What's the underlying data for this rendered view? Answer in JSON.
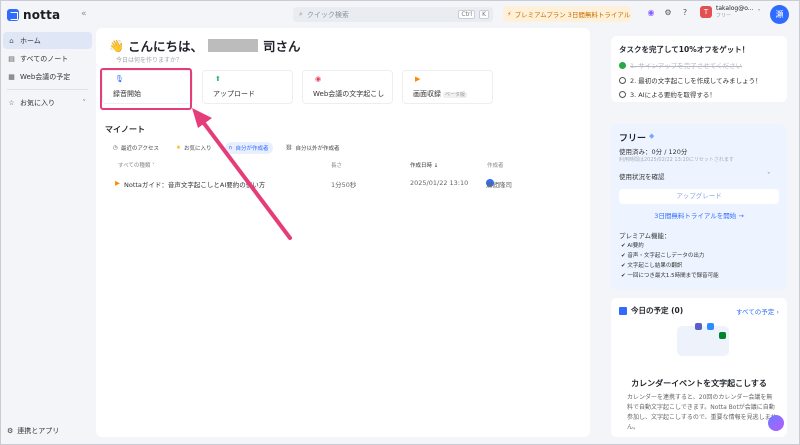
{
  "app": {
    "logo_text": "notta",
    "collapse_icon": "«"
  },
  "sidebar": {
    "items": [
      {
        "label": "ホーム",
        "icon": "home-icon",
        "active": true
      },
      {
        "label": "すべてのノート",
        "icon": "notes-icon"
      },
      {
        "label": "Web会議の予定",
        "icon": "calendar-icon"
      },
      {
        "label": "お気に入り",
        "icon": "star-icon"
      }
    ],
    "bottom_label": "連携とアプリ"
  },
  "topbar": {
    "search_placeholder": "クイック検索",
    "kbd_ctrl": "Ctrl",
    "kbd_k": "K",
    "promo": "プレミアムプラン 3日間無料トライアル",
    "user_name": "takalog@o...",
    "user_plan": "フリー",
    "user_initial": "T",
    "avatar_text": "瀬"
  },
  "home": {
    "greeting_prefix": "こんにちは、",
    "greeting_suffix": "司さん",
    "sub": "今日は何を作りますか？",
    "cards": [
      {
        "label": "録音開始",
        "icon": "mic-icon"
      },
      {
        "label": "アップロード",
        "icon": "upload-icon"
      },
      {
        "label": "Web会議の文字起こし",
        "icon": "meeting-icon"
      },
      {
        "label": "画面収録",
        "icon": "screen-record-icon",
        "badge": "ベータ版"
      }
    ],
    "mynotes_title": "マイノート",
    "filters": [
      "最近のアクセス",
      "お気に入り",
      "自分が作成者",
      "自分以外が作成者"
    ],
    "columns": {
      "type": "すべての種類 ˅",
      "length": "長さ",
      "created": "作成日時 ↓",
      "author": "作成者"
    },
    "rows": [
      {
        "title": "Nottaガイド：音声文字起こしとAI要約の使い方",
        "length": "1分50秒",
        "created": "2025/01/22 13:10",
        "author": "瀬間隆司"
      }
    ]
  },
  "task": {
    "title": "タスクを完了して10%オフをゲット！",
    "items": [
      {
        "label": "1. サインアップを完了させてください",
        "done": true
      },
      {
        "label": "2. 最初の文字起こしを作成してみましょう！",
        "done": false
      },
      {
        "label": "3. AIによる要約を取得する！",
        "done": false
      }
    ]
  },
  "plan": {
    "name": "フリー",
    "usage": "使用済み：0分 / 120分",
    "reset": "利用時間は2025/02/22 13:10にリセットされます",
    "check_usage": "使用状況を確認",
    "upgrade": "アップグレード",
    "trial": "3日間無料トライアルを開始 →",
    "premium_title": "プレミアム機能：",
    "premium_items": [
      "AI要約",
      "音声・文字起こしデータの出力",
      "文字起こし結果の翻訳",
      "一回につき最大1.5時間まで録音可能"
    ]
  },
  "schedule": {
    "title": "今日の予定 (0)",
    "all": "すべての予定 ›",
    "heading": "カレンダーイベントを文字起こしする",
    "desc": "カレンダーを連携すると、20回のカレンダー会議を無料で自動文字起こしできます。Notta Botが会議に自動参加し、文字起こしするので、重要な情報を見逃しません。"
  },
  "colors": {
    "accent": "#2f6bff",
    "highlight": "#e53d79",
    "promo": "#c46d00"
  }
}
